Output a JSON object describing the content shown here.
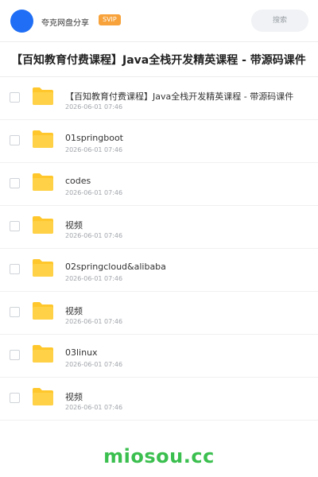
{
  "header": {
    "user_name": "夸克网盘分享",
    "badge": "SVIP",
    "search_placeholder": "搜索"
  },
  "title": "【百知教育付费课程】Java全栈开发精英课程 - 带源码课件",
  "items": [
    {
      "name": "【百知教育付费课程】Java全栈开发精英课程 - 带源码课件",
      "date": "2026-06-01 07:46"
    },
    {
      "name": "01springboot",
      "date": "2026-06-01 07:46"
    },
    {
      "name": "codes",
      "date": "2026-06-01 07:46"
    },
    {
      "name": "视频",
      "date": "2026-06-01 07:46"
    },
    {
      "name": "02springcloud&alibaba",
      "date": "2026-06-01 07:46"
    },
    {
      "name": "视频",
      "date": "2026-06-01 07:46"
    },
    {
      "name": "03linux",
      "date": "2026-06-01 07:46"
    },
    {
      "name": "视频",
      "date": "2026-06-01 07:46"
    }
  ],
  "footer": {
    "watermark": "miosou.cc"
  },
  "colors": {
    "avatar": "#1f6ef5",
    "badge": "#f7a23a",
    "folder": "#ffc72c",
    "watermark": "#3bbf4f"
  },
  "icons": {
    "folder": "folder-icon",
    "checkbox": "checkbox-icon"
  }
}
